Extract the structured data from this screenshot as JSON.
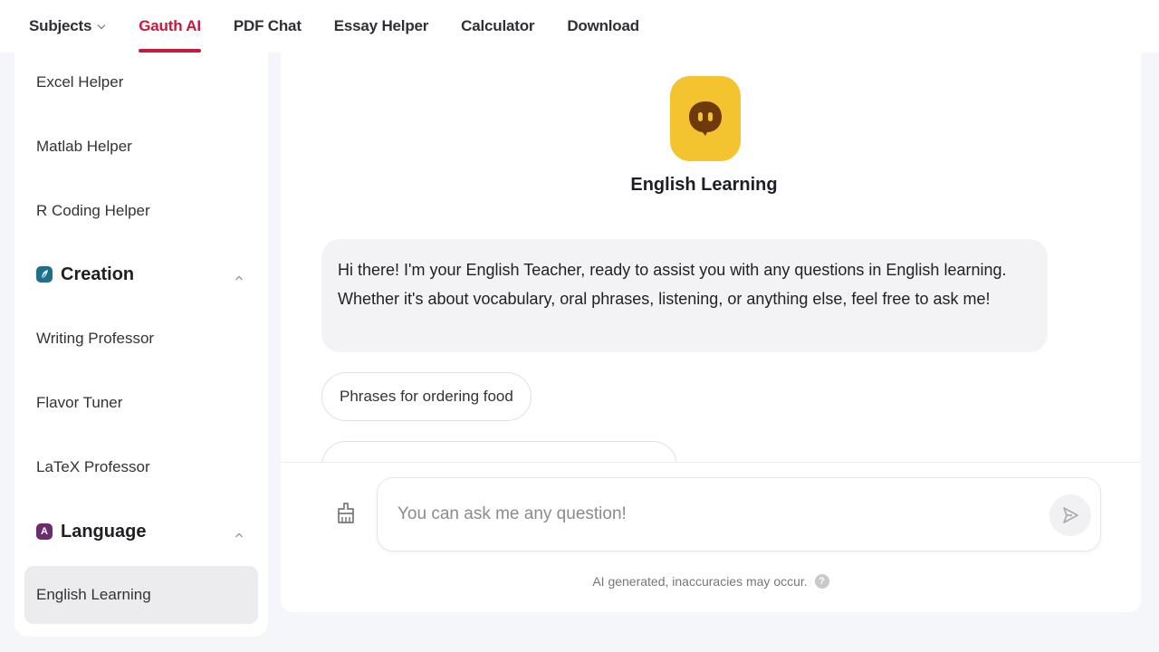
{
  "nav": {
    "items": [
      {
        "label": "Subjects",
        "has_dropdown": true,
        "active": false
      },
      {
        "label": "Gauth AI",
        "active": true
      },
      {
        "label": "PDF Chat",
        "active": false
      },
      {
        "label": "Essay Helper",
        "active": false
      },
      {
        "label": "Calculator",
        "active": false
      },
      {
        "label": "Download",
        "active": false
      }
    ],
    "active_color": "#c8183c"
  },
  "sidebar": {
    "items_top": [
      {
        "label": "Excel Helper"
      },
      {
        "label": "Matlab Helper"
      },
      {
        "label": "R Coding Helper"
      }
    ],
    "groups": [
      {
        "label": "Creation",
        "icon": "leaf-icon",
        "icon_color": "#1d6f8a",
        "expanded": true,
        "items": [
          {
            "label": "Writing Professor"
          },
          {
            "label": "Flavor Tuner"
          },
          {
            "label": "LaTeX Professor"
          }
        ]
      },
      {
        "label": "Language",
        "icon": "letter-a-icon",
        "icon_glyph": "A",
        "icon_color": "#6b2d6e",
        "expanded": true,
        "items": [
          {
            "label": "English Learning",
            "selected": true
          }
        ]
      }
    ]
  },
  "chat": {
    "bot_name": "English Learning",
    "bot_avatar_color": "#f4c430",
    "greeting": "Hi there! I'm your English Teacher, ready to assist you with any questions in English learning. Whether it's about vocabulary, oral phrases, listening, or anything else, feel free to ask me!",
    "suggestions": [
      {
        "label": "Phrases for ordering food"
      },
      {
        "label": ""
      }
    ],
    "input": {
      "placeholder": "You can ask me any question!",
      "value": ""
    },
    "disclaimer": "AI generated, inaccuracies may occur.",
    "help_glyph": "?"
  }
}
